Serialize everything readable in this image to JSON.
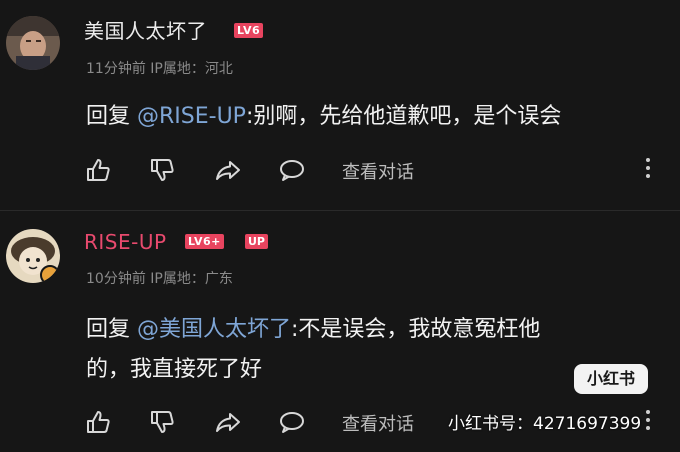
{
  "comments": [
    {
      "username": "美国人太坏了",
      "level_badge": "LV6",
      "time": "11分钟前",
      "ip_location": "IP属地：河北",
      "reply_prefix": "回复 ",
      "mention": "@RISE-UP",
      "text_line1": ":别啊，先给他道歉吧，是个误会",
      "view_conversation": "查看对话"
    },
    {
      "username": "RISE-UP",
      "level_badge": "LV6+",
      "up_badge": "UP",
      "time": "10分钟前",
      "ip_location": "IP属地：广东",
      "reply_prefix": "回复 ",
      "mention": "@美国人太坏了",
      "text_line1": ":不是误会，我故意冤枉他",
      "text_line2": "的，我直接死了好",
      "view_conversation": "查看对话"
    }
  ],
  "watermark": {
    "logo_text": "小红书",
    "id_text": "小红书号：4271697399"
  },
  "icons": {
    "like": "thumbs-up-icon",
    "dislike": "thumbs-down-icon",
    "share": "share-icon",
    "comment": "comment-bubble-icon",
    "more": "more-vertical-icon"
  },
  "colors": {
    "background": "#161616",
    "up_username": "#e84a6e",
    "badge": "#e8445f",
    "mention": "#7fa6d6"
  }
}
